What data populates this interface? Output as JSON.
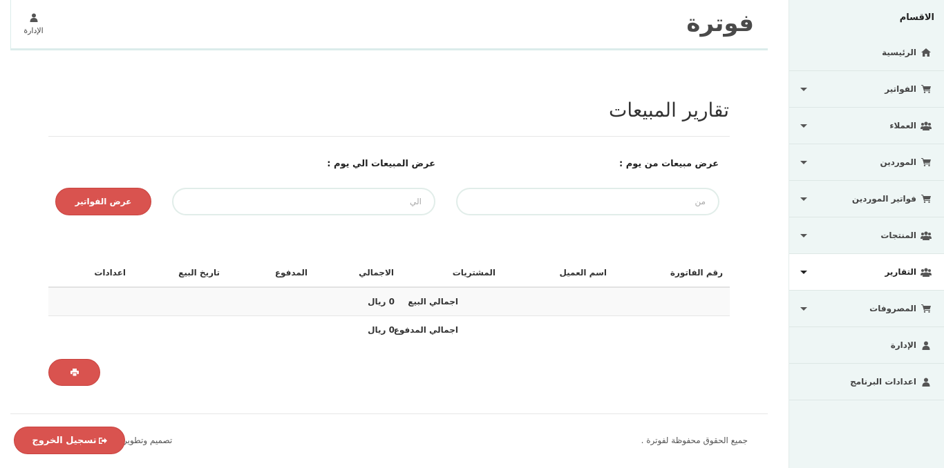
{
  "app": {
    "brand": "فوترة"
  },
  "header": {
    "admin_label": "الإدارة"
  },
  "sidebar": {
    "title": "الاقسام",
    "items": [
      {
        "label": "الرئيسية",
        "icon": "home-icon",
        "dropdown": false,
        "active": false
      },
      {
        "label": "الفواتير",
        "icon": "cart-icon",
        "dropdown": true,
        "active": false
      },
      {
        "label": "العملاء",
        "icon": "users-icon",
        "dropdown": true,
        "active": false
      },
      {
        "label": "الموردين",
        "icon": "cart-icon",
        "dropdown": true,
        "active": false
      },
      {
        "label": "فواتير الموردين",
        "icon": "cart-icon",
        "dropdown": true,
        "active": false
      },
      {
        "label": "المنتجات",
        "icon": "users-icon",
        "dropdown": true,
        "active": false
      },
      {
        "label": "التقارير",
        "icon": "users-icon",
        "dropdown": true,
        "active": true
      },
      {
        "label": "المصروفات",
        "icon": "cart-icon",
        "dropdown": true,
        "active": false
      },
      {
        "label": "الإدارة",
        "icon": "user-icon",
        "dropdown": false,
        "active": false
      },
      {
        "label": "اعدادات البرنامج",
        "icon": "user-icon",
        "dropdown": false,
        "active": false
      }
    ]
  },
  "main": {
    "title": "تقارير المبيعات",
    "from_label": "عرض مبيعات من يوم :",
    "to_label": "عرض المبيعات الي يوم :",
    "from_placeholder": "من",
    "to_placeholder": "الي",
    "show_button": "عرض الفواتير"
  },
  "table": {
    "headers": [
      "رقم الفاتورة",
      "اسم العميل",
      "المشتريات",
      "الاجمالي",
      "المدفوع",
      "تاريخ البيع",
      "اعدادات"
    ],
    "summary": [
      {
        "label": "اجمالي البيع",
        "value": "0 ريال"
      },
      {
        "label": "اجمالي المدفوع",
        "value": "0 ريال"
      }
    ]
  },
  "footer": {
    "rights": "جميع الحقوق محفوظة لفوترة .",
    "design": "تصميم وتطوير",
    "logout": "تسجيل الخروج"
  },
  "colors": {
    "accent": "#d9534f",
    "sidebar_bg": "#eef6f5",
    "border": "#dbeceb"
  }
}
